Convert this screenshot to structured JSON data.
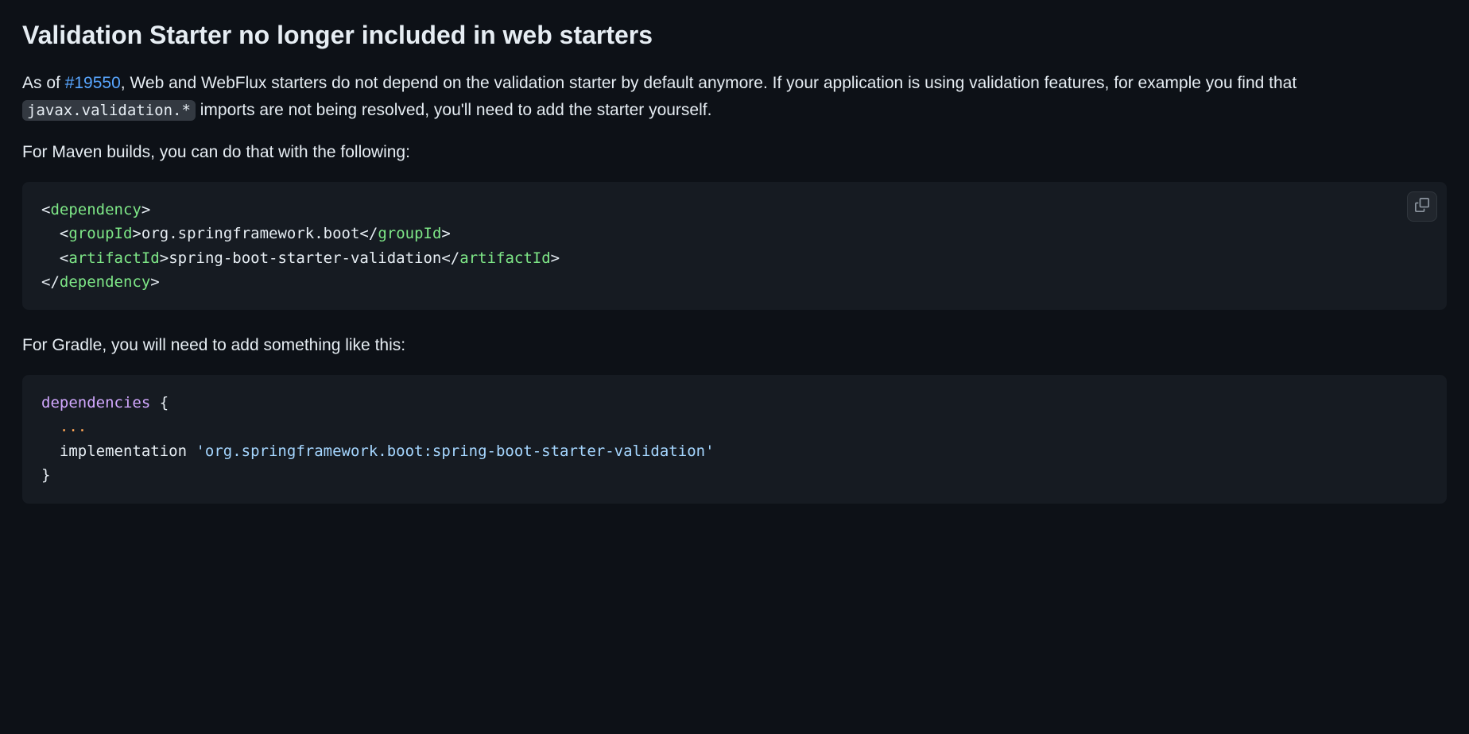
{
  "heading": "Validation Starter no longer included in web starters",
  "p1": {
    "pre": "As of ",
    "issue": "#19550",
    "mid": ", Web and WebFlux starters do not depend on the validation starter by default anymore. If your application is using validation features, for example you find that ",
    "code": "javax.validation.*",
    "post": " imports are not being resolved, you'll need to add the starter yourself."
  },
  "p2": "For Maven builds, you can do that with the following:",
  "maven": {
    "line1": {
      "open": "<",
      "tag1": "dependency",
      "close": ">"
    },
    "line2": {
      "indent": "  ",
      "open": "<",
      "tag": "groupId",
      "gt": ">",
      "text": "org.springframework.boot",
      "open2": "</",
      "tag2": "groupId",
      "gt2": ">"
    },
    "line3": {
      "indent": "  ",
      "open": "<",
      "tag": "artifactId",
      "gt": ">",
      "text": "spring-boot-starter-validation",
      "open2": "</",
      "tag2": "artifactId",
      "gt2": ">"
    },
    "line4": {
      "open": "</",
      "tag1": "dependency",
      "close": ">"
    }
  },
  "p3": "For Gradle, you will need to add something like this:",
  "gradle": {
    "l1_kw": "dependencies",
    "l1_brace": " {",
    "l2_indent": "  ",
    "l2_dots": "...",
    "l3_indent": "  ",
    "l3_impl": "implementation ",
    "l3_str": "'org.springframework.boot:spring-boot-starter-validation'",
    "l4_brace": "}"
  },
  "copy_label": "Copy"
}
